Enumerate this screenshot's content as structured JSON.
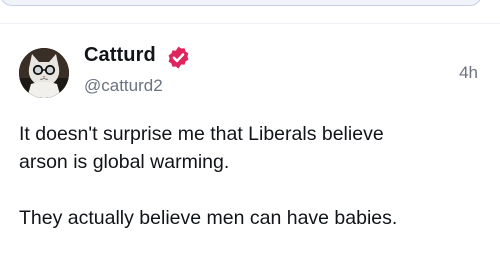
{
  "post": {
    "display_name": "Catturd",
    "handle": "@catturd2",
    "timestamp": "4h",
    "verified_icon": "verified-badge-icon",
    "verified_color": "#e0245e",
    "lines": [
      "It doesn't surprise me that Liberals believe",
      "arson is global warming.",
      "They actually believe men can have babies."
    ]
  },
  "colors": {
    "text_primary": "#111418",
    "text_secondary": "#6b7280",
    "divider": "#eceff3",
    "prev_card_fill": "#f1f3fb",
    "prev_card_border": "#c9cfe6"
  }
}
